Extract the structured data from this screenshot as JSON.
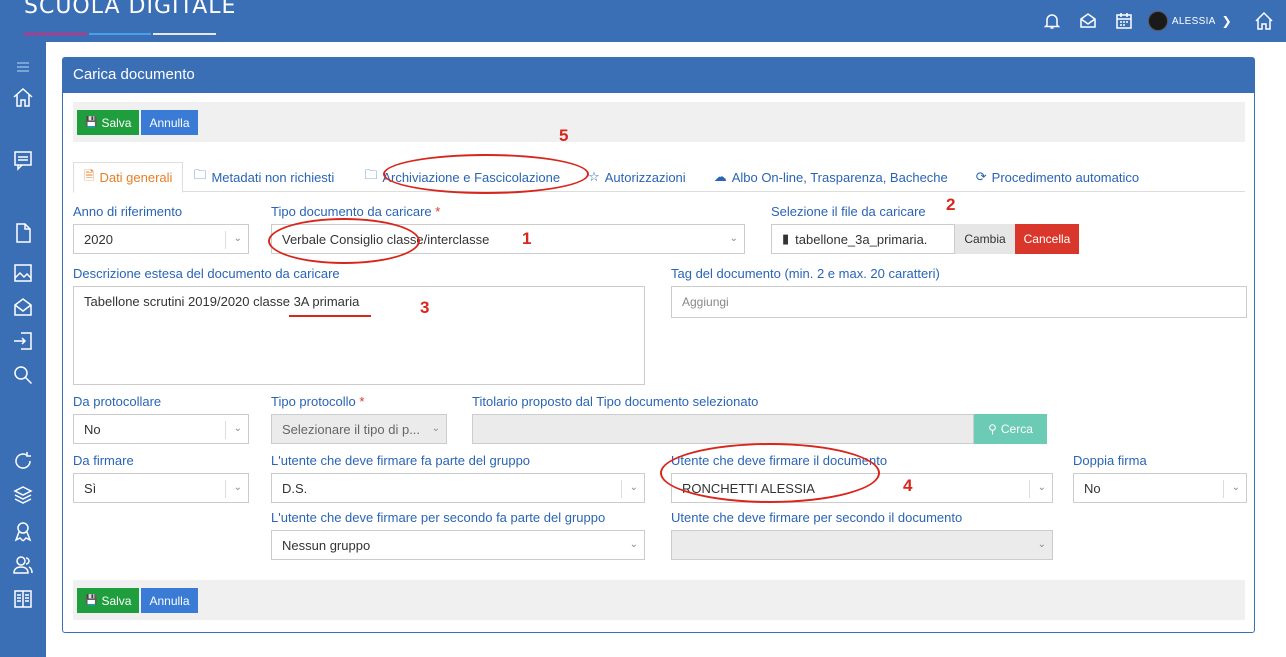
{
  "app": {
    "logo": "SCUOLA DIGITALE",
    "user_name": "ALESSIA",
    "logo_colors": [
      "#d62b7c",
      "#4aa0e6",
      "#e8e8e8"
    ]
  },
  "icons": {
    "bell": "bell-icon",
    "mail": "mail-icon",
    "calendar": "calendar-icon",
    "home": "home-icon"
  },
  "panel": {
    "title": "Carica documento"
  },
  "toolbar": {
    "save_label": "Salva",
    "cancel_label": "Annulla"
  },
  "tabs": [
    {
      "label": "Dati generali",
      "icon": "file-icon"
    },
    {
      "label": "Metadati non richiesti",
      "icon": "folder-icon"
    },
    {
      "label": "Archiviazione e Fascicolazione",
      "icon": "folder-icon"
    },
    {
      "label": "Autorizzazioni",
      "icon": "star-icon"
    },
    {
      "label": "Albo On-line, Trasparenza, Bacheche",
      "icon": "cloud-icon"
    },
    {
      "label": "Procedimento automatico",
      "icon": "refresh-icon"
    }
  ],
  "form": {
    "anno": {
      "label": "Anno di riferimento",
      "value": "2020"
    },
    "tipo_doc": {
      "label": "Tipo documento da caricare",
      "required": "*",
      "value": "Verbale Consiglio classe/interclasse"
    },
    "file": {
      "label": "Selezione il file da caricare",
      "filename": "tabellone_3a_primaria.",
      "change": "Cambia",
      "cancel": "Cancella"
    },
    "descrizione": {
      "label": "Descrizione estesa del documento da caricare",
      "value": "Tabellone scrutini 2019/2020 classe 3A primaria"
    },
    "tag": {
      "label": "Tag del documento (min. 2 e max. 20 caratteri)",
      "placeholder": "Aggiungi"
    },
    "da_protocollare": {
      "label": "Da protocollare",
      "value": "No"
    },
    "tipo_protocollo": {
      "label": "Tipo protocollo",
      "required": "*",
      "value": "Selezionare il tipo di p..."
    },
    "titolario": {
      "label": "Titolario proposto dal Tipo documento selezionato",
      "value": "",
      "search": "Cerca"
    },
    "da_firmare": {
      "label": "Da firmare",
      "value": "Sì"
    },
    "gruppo": {
      "label": "L'utente che deve firmare fa parte del gruppo",
      "value": "D.S."
    },
    "utente": {
      "label": "Utente che deve firmare il documento",
      "value": "RONCHETTI ALESSIA"
    },
    "doppia": {
      "label": "Doppia firma",
      "value": "No"
    },
    "gruppo2": {
      "label": "L'utente che deve firmare per secondo fa parte del gruppo",
      "value": "Nessun gruppo"
    },
    "utente2": {
      "label": "Utente che deve firmare per secondo il documento",
      "value": ""
    }
  },
  "annotations": {
    "a1": "1",
    "a2": "2",
    "a3": "3",
    "a4": "4",
    "a5": "5"
  }
}
